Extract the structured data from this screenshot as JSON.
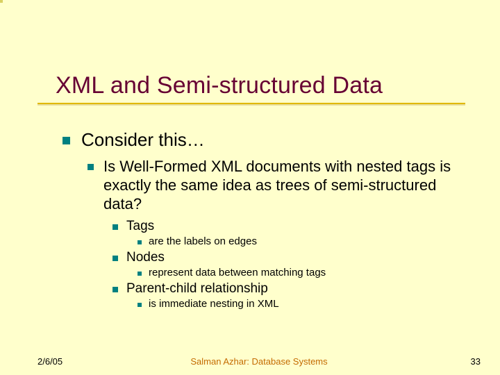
{
  "title": "XML and Semi-structured Data",
  "content": {
    "lvl1_text": "Consider this…",
    "lvl2_text": "Is Well-Formed XML documents with nested tags is exactly the same idea as trees of semi-structured data?",
    "items": [
      {
        "label": "Tags",
        "detail": "are the labels on edges"
      },
      {
        "label": "Nodes",
        "detail": "represent data between matching tags"
      },
      {
        "label": "Parent-child relationship",
        "detail": "is immediate nesting in XML"
      }
    ]
  },
  "footer": {
    "date": "2/6/05",
    "center": "Salman Azhar: Database Systems",
    "page": "33"
  }
}
